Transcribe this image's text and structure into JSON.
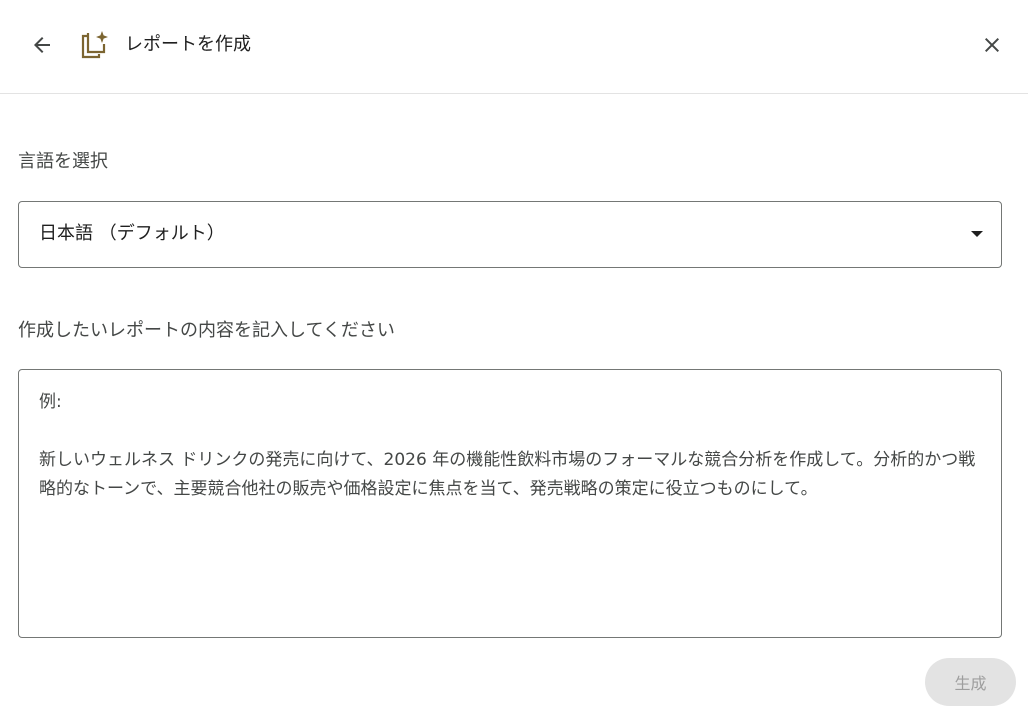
{
  "header": {
    "title": "レポートを作成",
    "back_icon": "arrow-back-icon",
    "report_icon": "report-sparkle-icon",
    "close_icon": "close-icon",
    "accent_color": "#7c6531"
  },
  "language": {
    "label": "言語を選択",
    "selected": "日本語 （デフォルト）"
  },
  "content": {
    "label": "作成したいレポートの内容を記入してください",
    "placeholder": "例:\n\n新しいウェルネス ドリンクの発売に向けて、2026 年の機能性飲料市場のフォーマルな競合分析を作成して。分析的かつ戦略的なトーンで、主要競合他社の販売や価格設定に焦点を当て、発売戦略の策定に役立つものにして。",
    "value": ""
  },
  "actions": {
    "generate_label": "生成",
    "generate_disabled": true
  }
}
